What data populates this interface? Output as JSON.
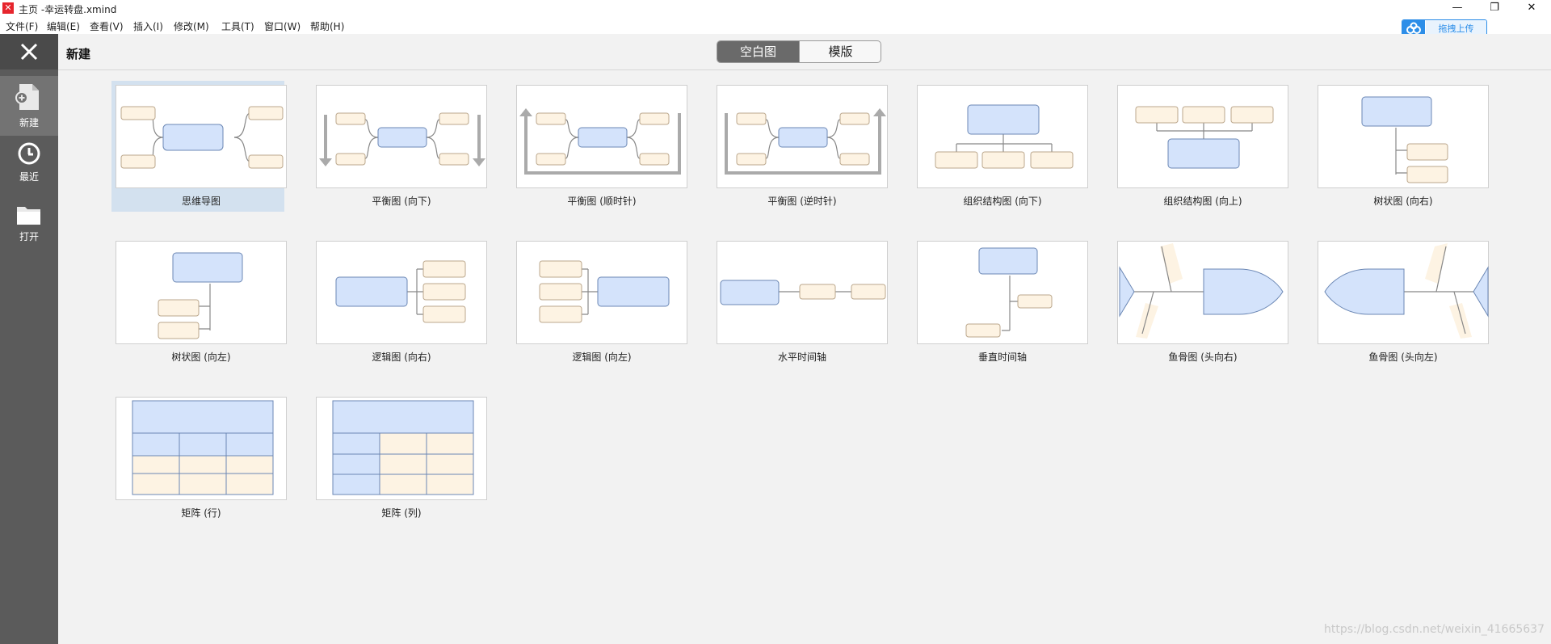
{
  "window": {
    "title": "主页 -幸运转盘.xmind",
    "controls": {
      "minimize": "—",
      "maximize": "❐",
      "close": "✕"
    }
  },
  "menu": [
    "文件(F)",
    "编辑(E)",
    "查看(V)",
    "插入(I)",
    "修改(M)",
    "工具(T)",
    "窗口(W)",
    "帮助(H)"
  ],
  "upload": {
    "label": "拖拽上传"
  },
  "sidebar": {
    "items": [
      {
        "label": "新建",
        "icon": "new-file-icon",
        "active": true
      },
      {
        "label": "最近",
        "icon": "clock-icon",
        "active": false
      },
      {
        "label": "打开",
        "icon": "folder-icon",
        "active": false
      }
    ]
  },
  "header": {
    "title": "新建",
    "tabs": [
      {
        "label": "空白图",
        "active": true
      },
      {
        "label": "模版",
        "active": false
      }
    ]
  },
  "templates": [
    {
      "label": "思维导图",
      "selected": true
    },
    {
      "label": "平衡图 (向下)"
    },
    {
      "label": "平衡图 (顺时针)"
    },
    {
      "label": "平衡图 (逆时针)"
    },
    {
      "label": "组织结构图 (向下)"
    },
    {
      "label": "组织结构图 (向上)"
    },
    {
      "label": "树状图 (向右)"
    },
    {
      "label": "树状图 (向左)"
    },
    {
      "label": "逻辑图 (向右)"
    },
    {
      "label": "逻辑图 (向左)"
    },
    {
      "label": "水平时间轴"
    },
    {
      "label": "垂直时间轴"
    },
    {
      "label": "鱼骨图 (头向右)"
    },
    {
      "label": "鱼骨图 (头向左)"
    },
    {
      "label": "矩阵 (行)"
    },
    {
      "label": "矩阵 (列)"
    }
  ],
  "watermark": "https://blog.csdn.net/weixin_41665637",
  "colors": {
    "topic_fill": "#d4e3fb",
    "topic_stroke": "#6b87b4",
    "sub_fill": "#fdf3e3",
    "sub_stroke": "#bba78c",
    "selection": "#d3e1ef"
  }
}
